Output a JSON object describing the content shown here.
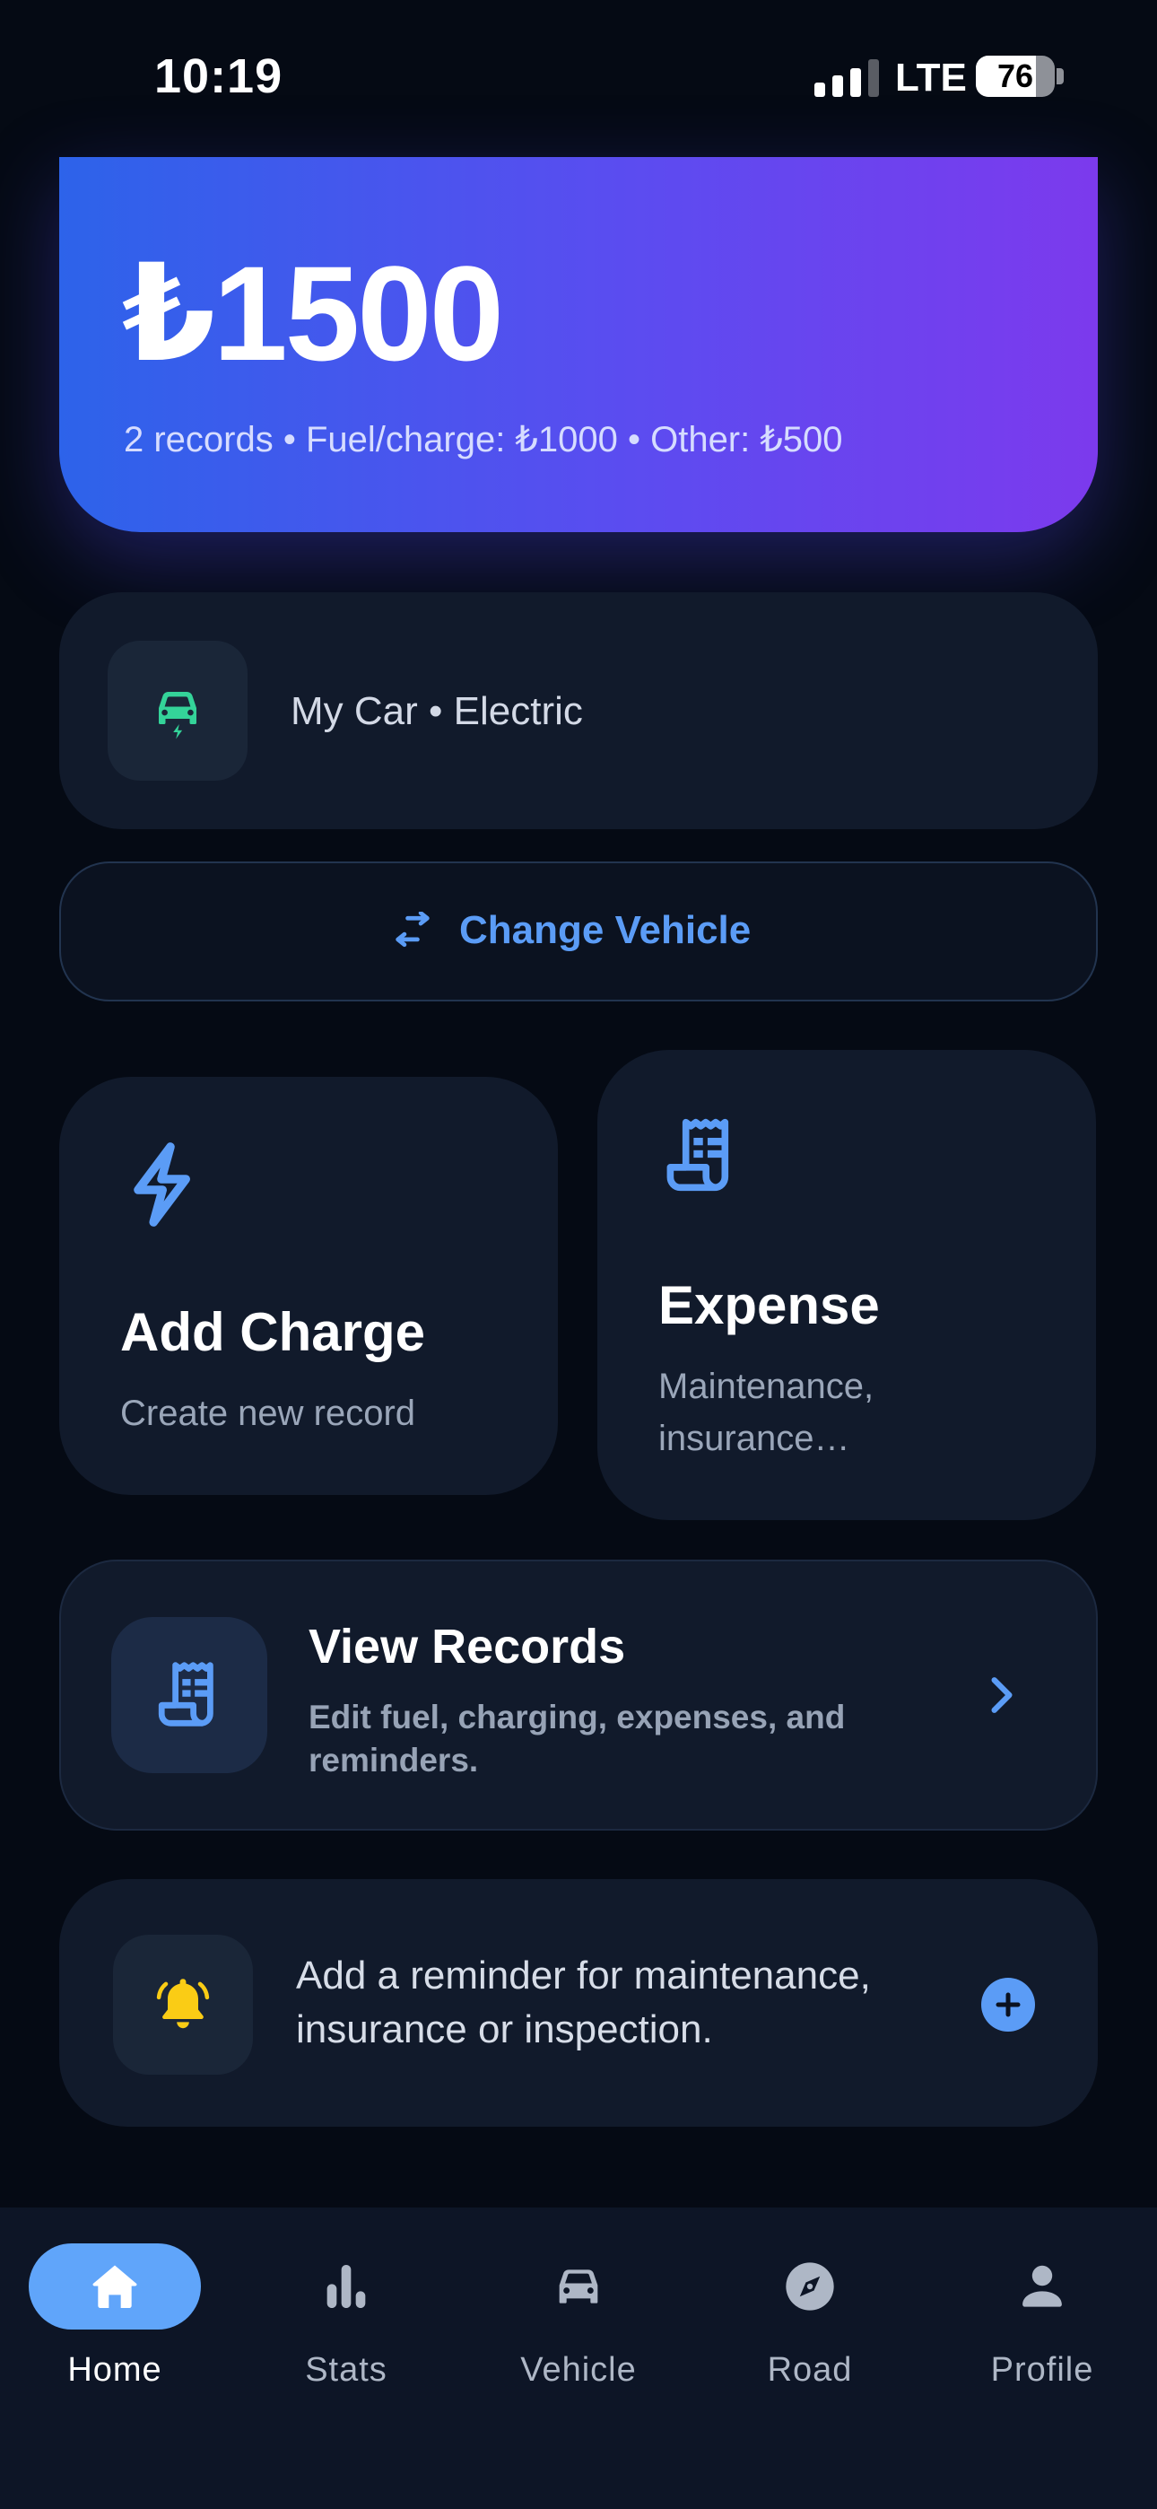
{
  "status_bar": {
    "time": "10:19",
    "network": "LTE",
    "battery": "76"
  },
  "summary": {
    "amount": "₺1500",
    "details": "2 records • Fuel/charge: ₺1000 • Other: ₺500",
    "gradient_start": "#2d63ea",
    "gradient_end": "#7c3aed"
  },
  "vehicle": {
    "label": "My Car • Electric",
    "icon": "electric-car-icon",
    "icon_color": "#34d399"
  },
  "change_vehicle": {
    "label": "Change Vehicle",
    "icon": "swap-icon"
  },
  "actions": {
    "add_charge": {
      "title": "Add Charge",
      "subtitle": "Create new record",
      "icon": "lightning-icon"
    },
    "expense": {
      "title": "Expense",
      "subtitle_line1": "Maintenance,",
      "subtitle_line2": "insurance…",
      "icon": "receipt-icon"
    }
  },
  "records": {
    "title": "View Records",
    "description": "Edit fuel, charging, expenses, and reminders.",
    "icon": "receipt-icon"
  },
  "reminder": {
    "text": "Add a reminder for maintenance, insurance or inspection.",
    "icon": "bell-icon",
    "icon_color": "#facc15",
    "action_icon": "plus-circle-icon"
  },
  "tabs": [
    {
      "label": "Home",
      "icon": "home-icon",
      "active": true
    },
    {
      "label": "Stats",
      "icon": "bar-chart-icon",
      "active": false
    },
    {
      "label": "Vehicle",
      "icon": "car-icon",
      "active": false
    },
    {
      "label": "Road",
      "icon": "compass-icon",
      "active": false
    },
    {
      "label": "Profile",
      "icon": "person-icon",
      "active": false
    }
  ],
  "accent_color": "#5b9cf6"
}
